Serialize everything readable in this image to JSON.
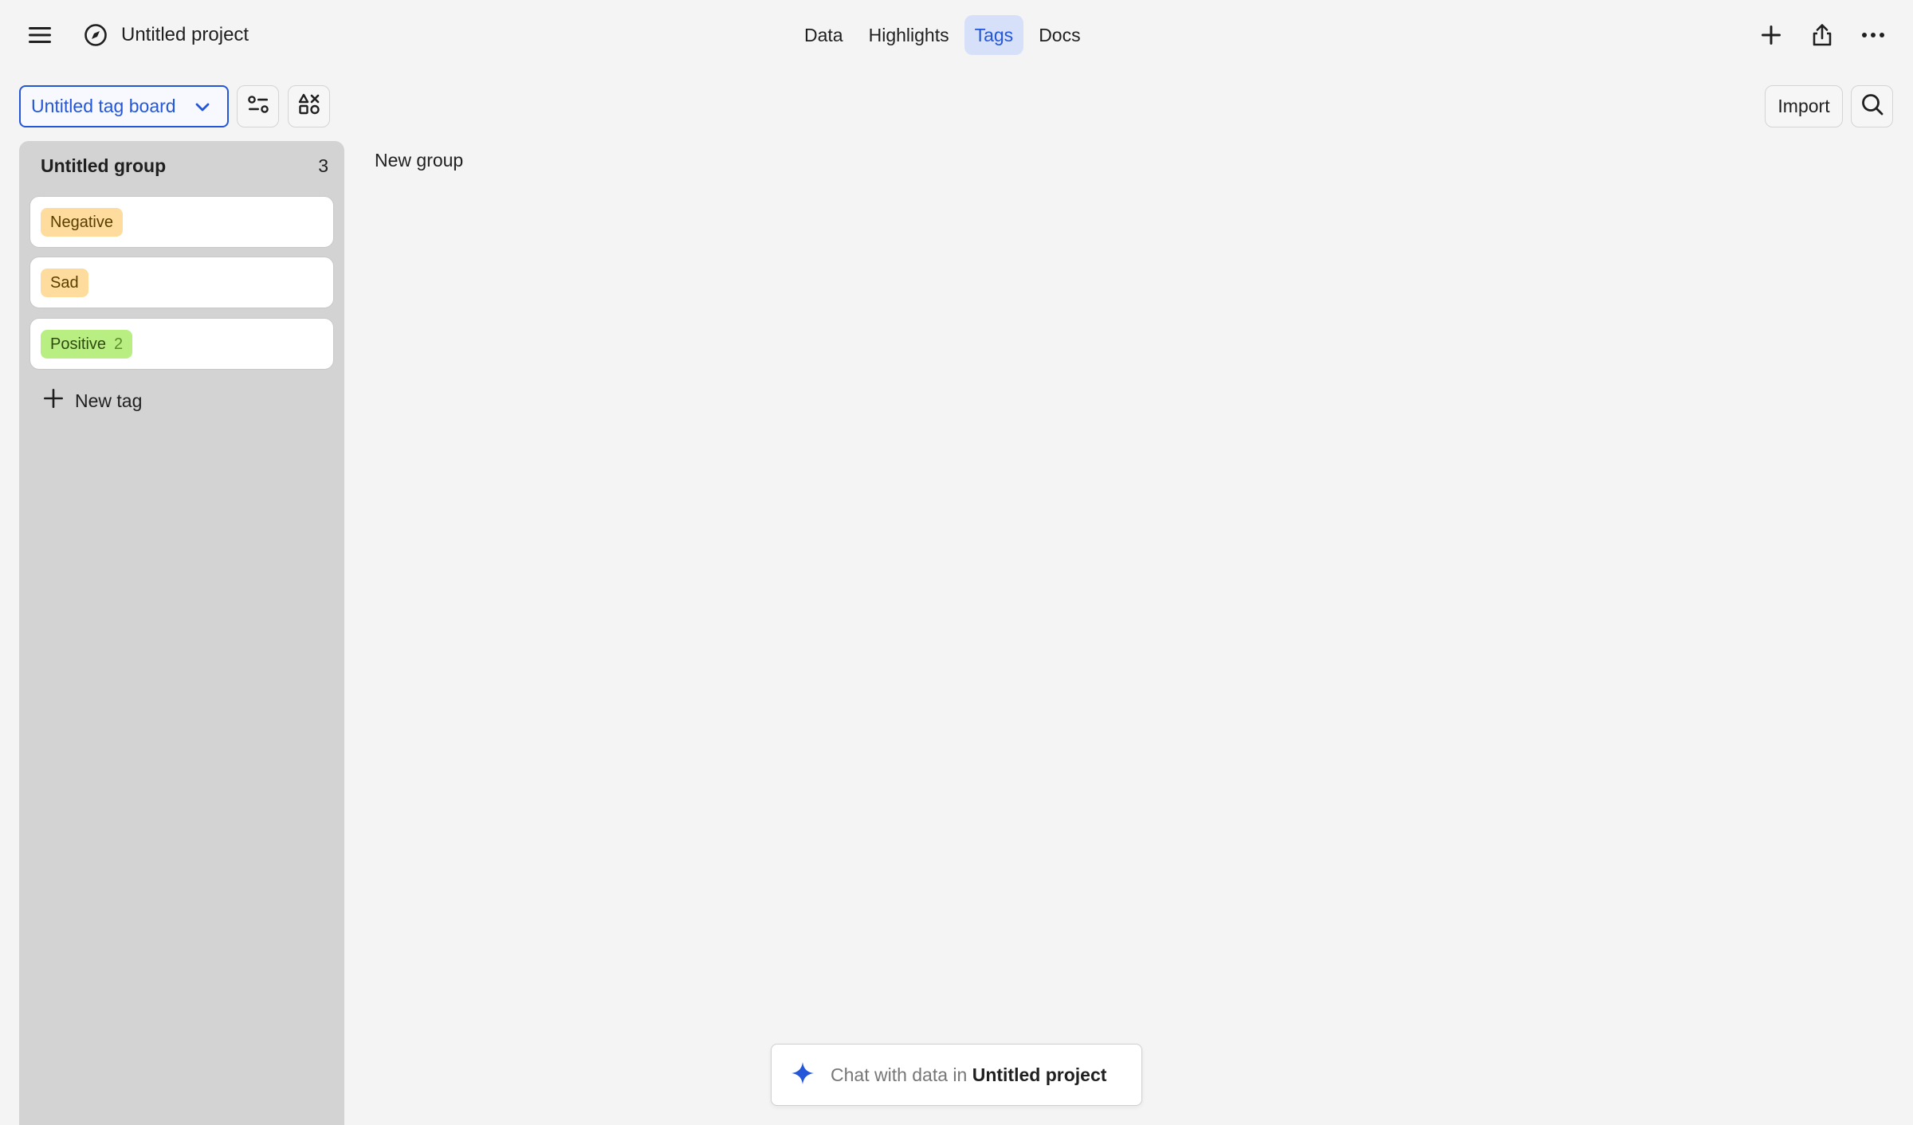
{
  "header": {
    "project_title": "Untitled project",
    "tabs": [
      {
        "label": "Data",
        "active": false
      },
      {
        "label": "Highlights",
        "active": false
      },
      {
        "label": "Tags",
        "active": true
      },
      {
        "label": "Docs",
        "active": false
      }
    ],
    "icons": {
      "menu": "hamburger-menu-icon",
      "project": "compass-icon",
      "add": "plus-icon",
      "share": "share-icon",
      "more": "ellipsis-icon"
    }
  },
  "toolbar": {
    "board_select_label": "Untitled tag board",
    "import_label": "Import",
    "icons": {
      "chevron": "chevron-down-icon",
      "filter": "filter-settings-icon",
      "shapes": "shapes-icon",
      "search": "search-icon"
    }
  },
  "board": {
    "groups": [
      {
        "title": "Untitled group",
        "count": "3",
        "tags": [
          {
            "label": "Negative",
            "count": "",
            "color": "#fddc9d",
            "text_color": "#5a3e00"
          },
          {
            "label": "Sad",
            "count": "",
            "color": "#fddc9d",
            "text_color": "#5a3e00"
          },
          {
            "label": "Positive",
            "count": "2",
            "color": "#b8ee82",
            "text_color": "#2f4a10"
          }
        ],
        "new_tag_label": "New tag"
      }
    ],
    "new_group_label": "New group"
  },
  "chat": {
    "prefix": "Chat with data in",
    "project": "Untitled project",
    "icon": "sparkle-icon"
  },
  "colors": {
    "accent": "#2356d8",
    "active_tab_bg": "#d6e0f8",
    "group_bg": "#d3d3d3",
    "page_bg": "#f4f4f4"
  }
}
